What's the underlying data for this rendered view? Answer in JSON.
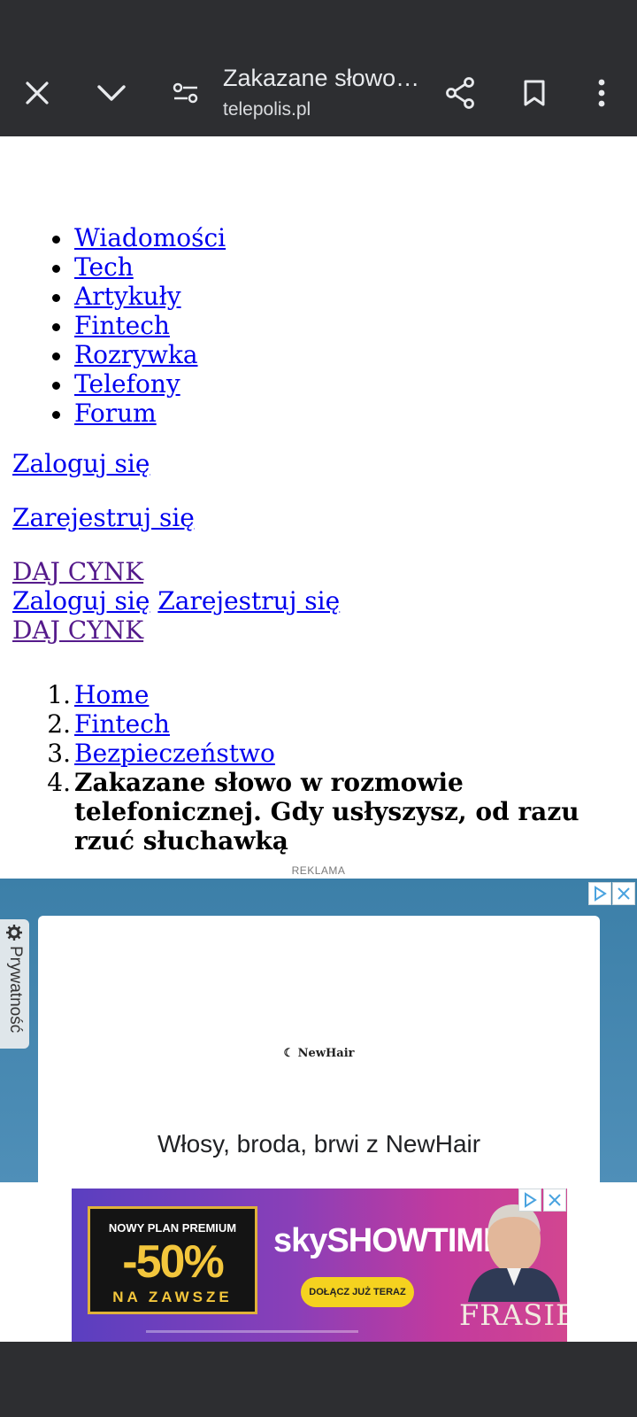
{
  "toolbar": {
    "title": "Zakazane słowo w rozmowie telefonicznej. Gdy usłyszysz, od razu rzuć słuchawką",
    "url": "telepolis.pl"
  },
  "nav": {
    "items": [
      "Wiadomości",
      "Tech",
      "Artykuły",
      "Fintech",
      "Rozrywka",
      "Telefony",
      "Forum"
    ]
  },
  "auth": {
    "login": "Zaloguj się",
    "register": "Zarejestruj się",
    "tip": "DAJ CYNK"
  },
  "breadcrumb": {
    "items": [
      "Home",
      "Fintech",
      "Bezpieczeństwo"
    ],
    "current": "Zakazane słowo w rozmowie telefonicznej. Gdy usłyszysz, od razu rzuć słuchawką",
    "numbers": [
      "1.",
      "2.",
      "3.",
      "4."
    ]
  },
  "ad": {
    "label": "REKLAMA",
    "privacy": "Prywatność",
    "logo": "NewHair",
    "headline": "Włosy, broda, brwi z NewHair"
  },
  "banner": {
    "promo_top": "NOWY PLAN PREMIUM",
    "promo_pct": "-50%",
    "promo_bottom": "NA ZAWSZE",
    "brand": "skySHOWTIME",
    "cta": "DOŁĄCZ JUŻ TERAZ",
    "show": "FRASIER"
  },
  "colors": {
    "toolbar": "#2d2e31",
    "link": "#0000ee",
    "visited": "#551a8b",
    "ad_bg": "#3c7fa8"
  }
}
